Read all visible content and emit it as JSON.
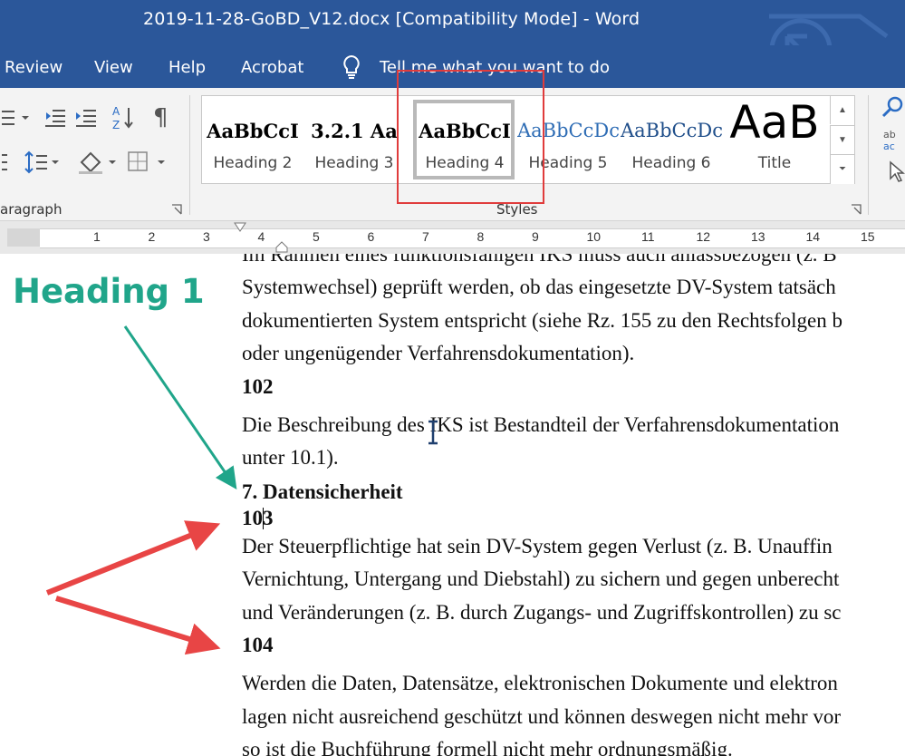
{
  "window": {
    "title": "2019-11-28-GoBD_V12.docx [Compatibility Mode]  -  Word"
  },
  "menu": {
    "items": [
      "Review",
      "View",
      "Help",
      "Acrobat"
    ],
    "tell_me": "Tell me what you want to do"
  },
  "ribbon": {
    "paragraph_label": "aragraph",
    "styles_label": "Styles",
    "pilcrow": "¶",
    "sort_glyph": "A↓Z",
    "styles": [
      {
        "sample": "AaBbCcI",
        "name": "Heading 2"
      },
      {
        "sample": "3.2.1 Aa",
        "name": "Heading 3"
      },
      {
        "sample": "AaBbCcI",
        "name": "Heading 4"
      },
      {
        "sample": "AaBbCcDc",
        "name": "Heading 5"
      },
      {
        "sample": "AaBbCcDc",
        "name": "Heading 6"
      },
      {
        "sample": "AaB",
        "name": "Title"
      }
    ],
    "selected_style": "Heading 4",
    "icons": [
      "list-icon",
      "outdent-icon",
      "indent-icon",
      "sort-icon",
      "pilcrow-icon",
      "line-spacing-icon",
      "shading-icon",
      "borders-icon",
      "find-icon",
      "replace-icon",
      "select-icon"
    ]
  },
  "ruler": {
    "numbers": [
      "1",
      "2",
      "3",
      "4",
      "5",
      "6",
      "7",
      "8",
      "9",
      "10",
      "11",
      "12",
      "13",
      "14",
      "15"
    ]
  },
  "document": {
    "lines": [
      "Im Rahmen eines funktionsfähigen IKS muss auch anlassbezogen (z. B",
      "Systemwechsel) geprüft werden, ob das eingesetzte DV-System tatsäch",
      "dokumentierten System entspricht (siehe Rz. 155 zu den Rechtsfolgen b",
      "oder ungenügender Verfahrensdokumentation)."
    ],
    "para_102_num": "102",
    "para_102": [
      "Die Beschreibung des IKS ist Bestandteil der Verfahrensdokumentation",
      "unter 10.1)."
    ],
    "heading_7": "7. Datensicherheit",
    "para_103_num": "103",
    "para_103": [
      "Der Steuerpflichtige hat sein DV-System gegen Verlust (z. B. Unauffin",
      "Vernichtung, Untergang und Diebstahl) zu sichern und gegen unberecht",
      "und Veränderungen (z. B. durch Zugangs- und Zugriffskontrollen) zu sc"
    ],
    "para_104_num": "104",
    "para_104": [
      "Werden die Daten, Datensätze, elektronischen Dokumente und elektron",
      "lagen nicht ausreichend geschützt und können deswegen nicht mehr vor",
      "so ist die Buchführung formell nicht mehr ordnungsmäßig."
    ]
  },
  "annotation": {
    "heading_label": "Heading 1",
    "heading_color": "#20a58a",
    "arrow_color": "#e84545",
    "highlight_color": "#e03c3c"
  },
  "colors": {
    "titlebar": "#2b579a"
  }
}
